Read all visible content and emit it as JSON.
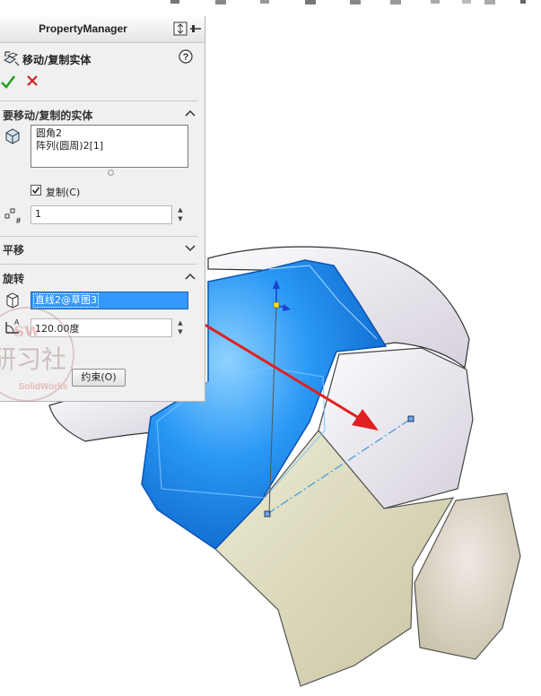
{
  "property_manager": {
    "title": "PropertyManager",
    "feature_name": "移动/复制实体",
    "sections": {
      "bodies": {
        "title": "要移动/复制的实体",
        "items": [
          "圆角2",
          "阵列(圆周)2[1]"
        ],
        "copy_label": "复制(C)",
        "copy_checked": true,
        "copies_value": "1"
      },
      "translate": {
        "title": "平移"
      },
      "rotate": {
        "title": "旋转",
        "reference": "直线2@草图3",
        "angle_value": "120.00度",
        "constraints_button": "约束(O)"
      }
    }
  },
  "watermark": {
    "logo_text": "SW",
    "chinese_text": "研习社",
    "english_text": "SolidWorks"
  },
  "colors": {
    "accent_blue": "#1f8df0",
    "selection_blue": "#3399ff",
    "ok_green": "#21a01f",
    "cancel_red": "#d42121",
    "arrow_red": "#e02020",
    "face_white": "#e9e6ec",
    "face_cream": "#d9d5b4"
  }
}
